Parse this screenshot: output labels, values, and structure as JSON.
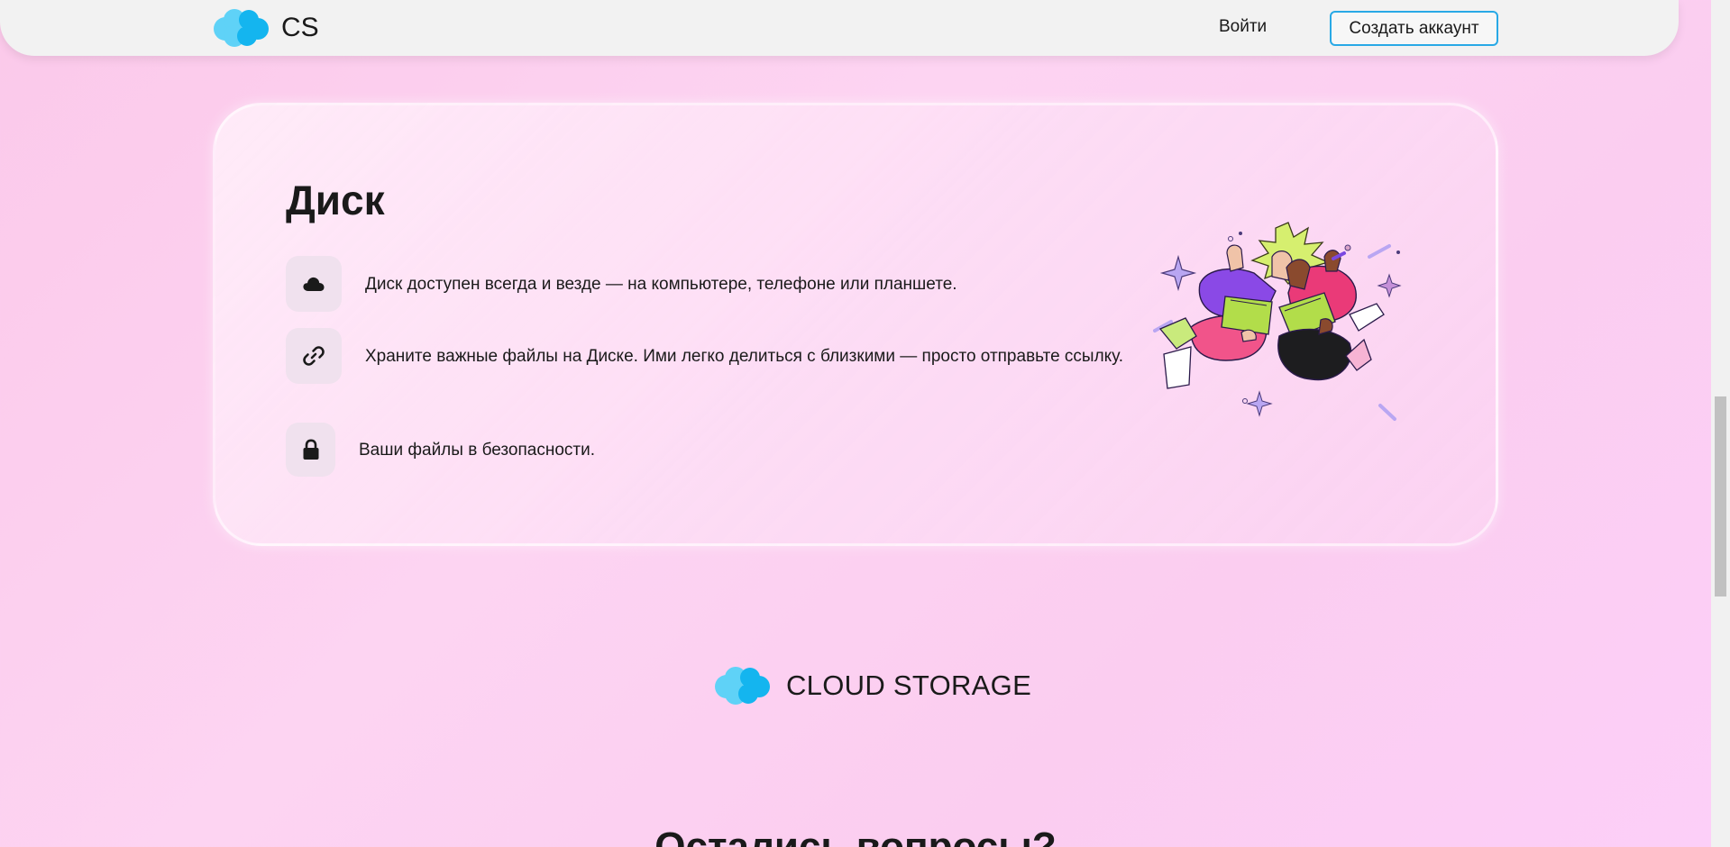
{
  "header": {
    "logo_text": "CS",
    "login_label": "Войти",
    "signup_label": "Создать аккаунт"
  },
  "card": {
    "title": "Диск",
    "features": [
      {
        "icon": "cloud-icon",
        "text": "Диск доступен всегда и везде — на компьютере, телефоне или планшете."
      },
      {
        "icon": "link-icon",
        "text": "Храните важные файлы на Диске. Ими легко делиться с близкими — просто отправьте ссылку."
      },
      {
        "icon": "lock-icon",
        "text": "Ваши файлы в безопасности."
      }
    ]
  },
  "footer": {
    "logo_text": "CLOUD STORAGE"
  },
  "faq": {
    "heading": "Остались вопросы?"
  },
  "colors": {
    "accent": "#29a9e6",
    "logo_light": "#5fd2f7",
    "logo_dark": "#14b5ef"
  }
}
